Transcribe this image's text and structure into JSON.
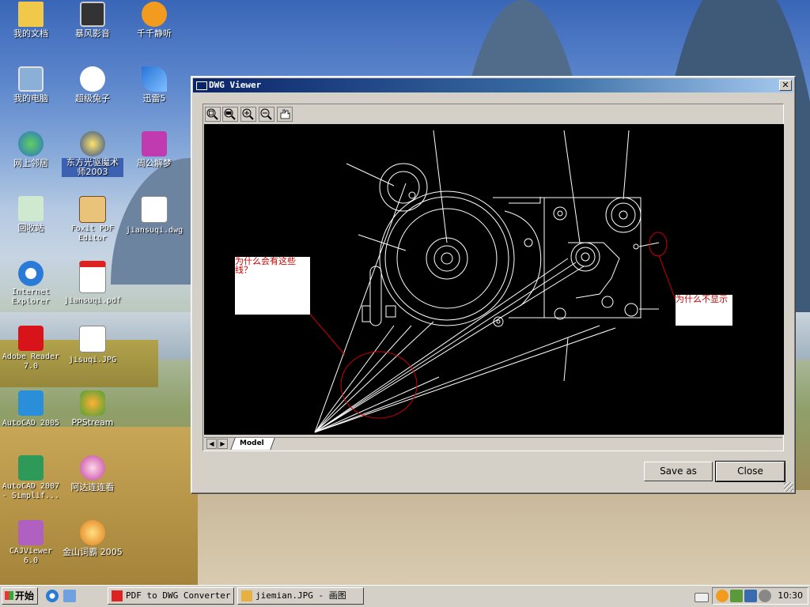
{
  "desktop": {
    "icons": [
      {
        "label": "我的文档"
      },
      {
        "label": "暴风影音"
      },
      {
        "label": "千千静听"
      },
      {
        "label": "我的电脑"
      },
      {
        "label": "超级兔子"
      },
      {
        "label": "迅雷5"
      },
      {
        "label": "网上邻居"
      },
      {
        "label": "东方光驱魔术师2003"
      },
      {
        "label": "周公解梦"
      },
      {
        "label": "回收站"
      },
      {
        "label": "Foxit PDF Editor"
      },
      {
        "label": "jiansuqi.dwg"
      },
      {
        "label": "Internet Explorer"
      },
      {
        "label": "jiansuqi.pdf"
      },
      {
        "label": "Adobe Reader 7.0"
      },
      {
        "label": "jisuqi.JPG"
      },
      {
        "label": "AutoCAD 2005"
      },
      {
        "label": "PPStream"
      },
      {
        "label": "AutoCAD 2007 - Simplif..."
      },
      {
        "label": "阿达连连看"
      },
      {
        "label": "CAJViewer 6.0"
      },
      {
        "label": "金山词霸 2005"
      }
    ]
  },
  "window": {
    "title": "DWG Viewer",
    "close_glyph": "✕",
    "toolbar_icons": [
      "zoom-window-icon",
      "zoom-extents-icon",
      "zoom-in-icon",
      "zoom-out-icon",
      "pan-icon"
    ],
    "layout_tab": "Model",
    "nav_prev": "◀",
    "nav_next": "▶",
    "buttons": {
      "save_as": "Save as",
      "close": "Close"
    },
    "annotations": {
      "left": "为什么会有这些线？",
      "right": "为什么不显示"
    },
    "colors": {
      "canvas_bg": "#000000",
      "drawing": "#ffffff",
      "markup": "#cc0000"
    }
  },
  "taskbar": {
    "start_label": "开始",
    "tasks": [
      {
        "label": "PDF to DWG Converter"
      },
      {
        "label": "jiemian.JPG - 画图"
      }
    ],
    "clock": "10:30"
  }
}
